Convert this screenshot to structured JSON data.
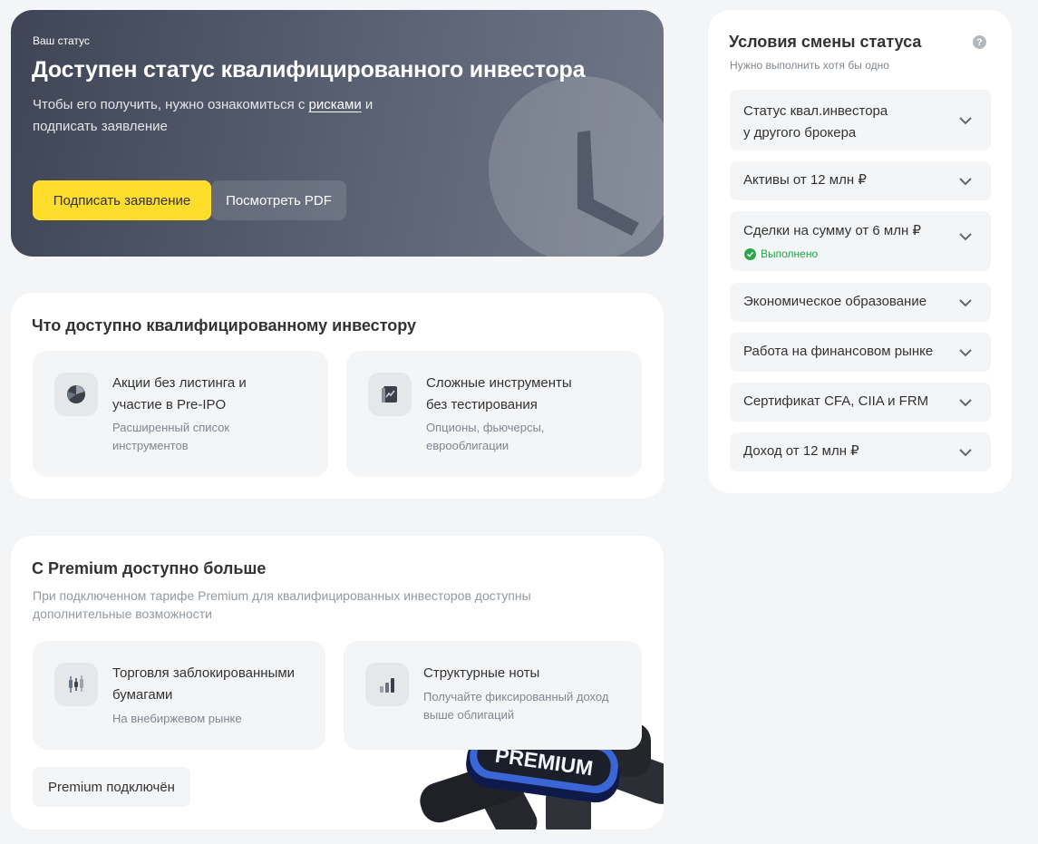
{
  "hero": {
    "eyebrow": "Ваш статус",
    "title": "Доступен статус квалифицированного инвестора",
    "subtitle_before": "Чтобы его получить, нужно ознакомиться с ",
    "subtitle_link": "рисками",
    "subtitle_after": " и подписать заявление",
    "primary_button": "Подписать заявление",
    "secondary_button": "Посмотреть PDF"
  },
  "qualified": {
    "title": "Что доступно квалифицированному инвестору",
    "features": [
      {
        "icon": "pie-chart-icon",
        "title_line1": "Акции без листинга и",
        "title_line2": "участие в Pre-IPO",
        "desc_line1": "Расширенный список",
        "desc_line2": "инструментов"
      },
      {
        "icon": "chart-document-icon",
        "title_line1": "Сложные инструменты",
        "title_line2": "без тестирования",
        "desc_line1": "Опционы, фьючерсы,",
        "desc_line2": "еврооблигации"
      }
    ]
  },
  "premium": {
    "title": "С Premium доступно больше",
    "subtitle_line1": "При подключенном тарифе Premium для квалифицированных инвесторов доступны",
    "subtitle_line2": "дополнительные возможности",
    "features": [
      {
        "icon": "candlestick-icon",
        "title_line1": "Торговля заблокированными",
        "title_line2": "бумагами",
        "desc_line1": "На внебиржевом рынке"
      },
      {
        "icon": "bar-chart-icon",
        "title_line1": "Структурные ноты",
        "desc_line1": "Получайте фиксированный доход",
        "desc_line2": "выше облигаций"
      }
    ],
    "status_button": "Premium подключён",
    "badge_text": "PREMIUM"
  },
  "conditions": {
    "title": "Условия смены статуса",
    "subtitle": "Нужно выполнить хотя бы одно",
    "help_glyph": "?",
    "items": [
      {
        "label_line1": "Статус квал.инвестора",
        "label_line2": "у другого брокера"
      },
      {
        "label_line1": "Активы от 12 млн ₽"
      },
      {
        "label_line1": "Сделки на сумму от 6 млн ₽",
        "status": "Выполнено"
      },
      {
        "label_line1": "Экономическое образование"
      },
      {
        "label_line1": "Работа на финансовом рынке"
      },
      {
        "label_line1": "Сертификат CFA, CIIA и FRM"
      },
      {
        "label_line1": "Доход от 12 млн ₽"
      }
    ]
  },
  "colors": {
    "accent_yellow": "#ffdd2d",
    "success_green": "#29a847",
    "premium_blue": "#3a66d6"
  }
}
